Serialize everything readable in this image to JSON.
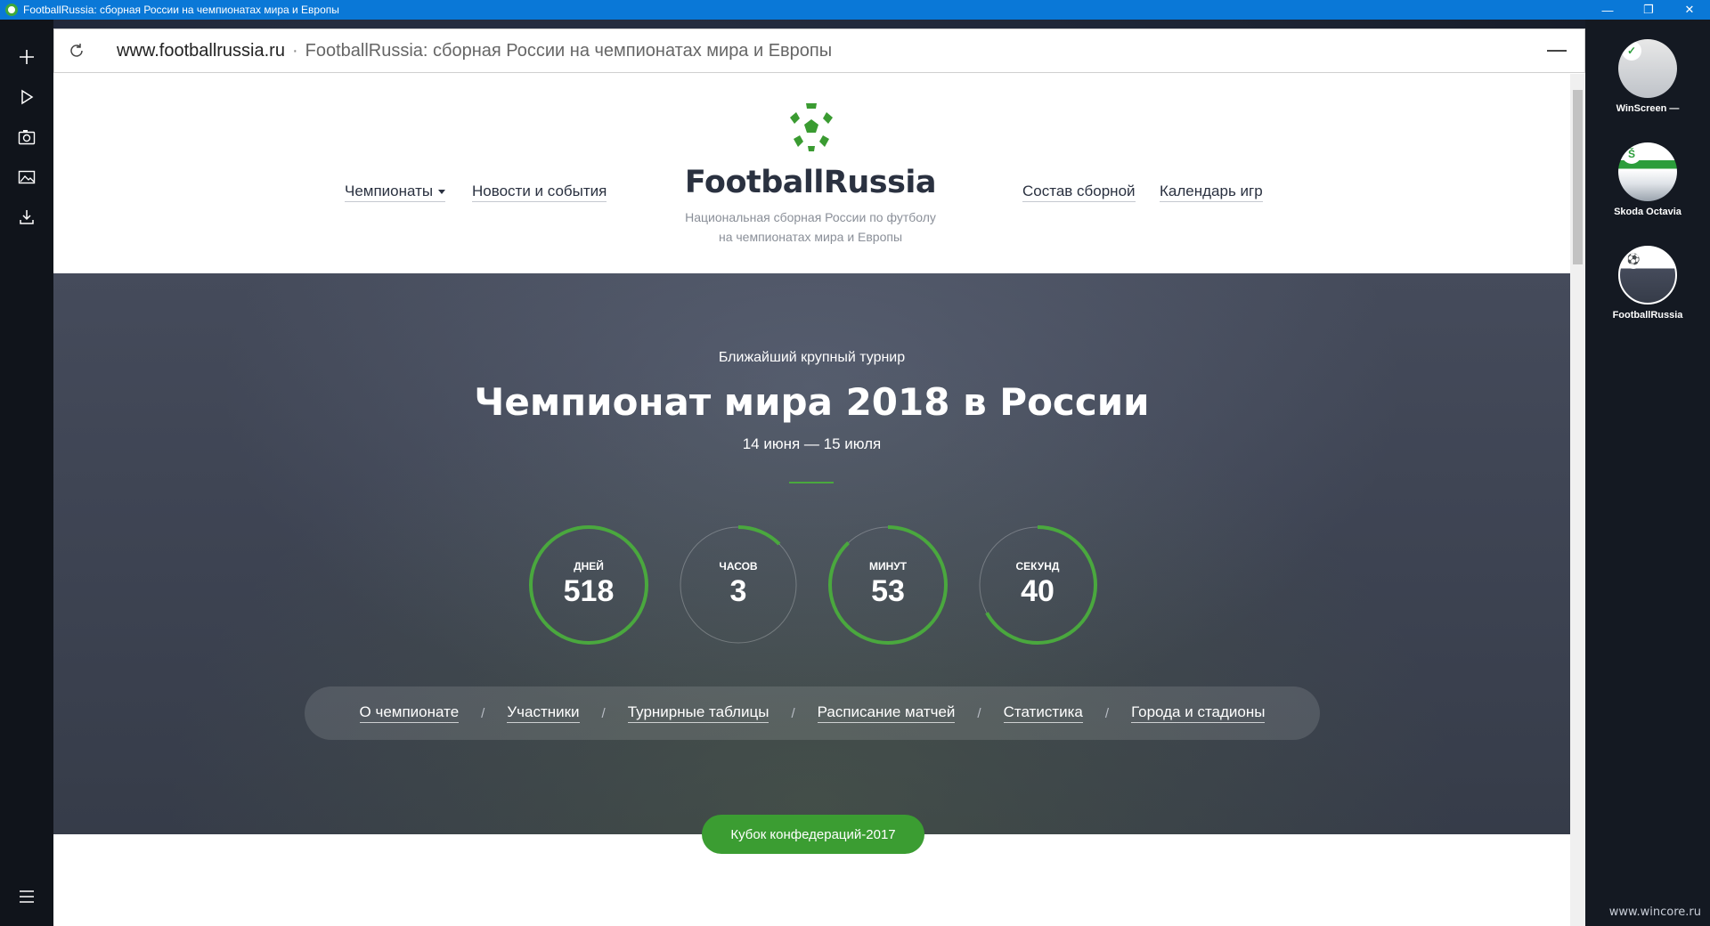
{
  "window": {
    "title": "FootballRussia: сборная России на чемпионатах мира и Европы",
    "controls": [
      "—",
      "❐",
      "✕"
    ]
  },
  "browser": {
    "url": "www.footballrussia.ru",
    "separator": "·",
    "page_title": "FootballRussia: сборная России на чемпионатах мира и Европы"
  },
  "header": {
    "brand": "FootballRussia",
    "tagline_line1": "Национальная сборная России по футболу",
    "tagline_line2": "на чемпионатах мира и Европы",
    "nav_left": [
      "Чемпионаты",
      "Новости и события"
    ],
    "nav_right": [
      "Состав сборной",
      "Календарь игр"
    ]
  },
  "hero": {
    "subtitle": "Ближайший крупный турнир",
    "title": "Чемпионат мира 2018 в России",
    "dates": "14 июня — 15 июля",
    "countdown": [
      {
        "label": "ДНЕЙ",
        "value": "518",
        "progress": 1.0
      },
      {
        "label": "ЧАСОВ",
        "value": "3",
        "progress": 0.125
      },
      {
        "label": "МИНУТ",
        "value": "53",
        "progress": 0.88
      },
      {
        "label": "СЕКУНД",
        "value": "40",
        "progress": 0.67
      }
    ],
    "subnav": [
      "О чемпионате",
      "Участники",
      "Турнирные таблицы",
      "Расписание матчей",
      "Статистика",
      "Города и стадионы"
    ],
    "subnav_separator": "/",
    "cup_button": "Кубок конфедераций-2017"
  },
  "right_sidebar": [
    {
      "label": "WinScreen —",
      "badge": "✓"
    },
    {
      "label": "Skoda Octavia",
      "badge": "Š"
    },
    {
      "label": "FootballRussia",
      "badge": "⚽"
    }
  ],
  "watermark": "www.wincore.ru",
  "colors": {
    "accent": "#4aa83e",
    "titlebar": "#0a78d7",
    "hero_bg": "#3e4453"
  }
}
